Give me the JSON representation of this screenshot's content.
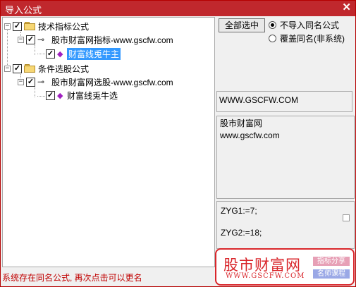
{
  "window": {
    "title": "导入公式",
    "close_glyph": "✕"
  },
  "tree": {
    "groups": [
      {
        "label": "技术指标公式",
        "child": "股市财富网指标-www.gscfw.com",
        "leaf": "财富线兎牛主",
        "leaf_selected": true
      },
      {
        "label": "条件选股公式",
        "child": "股市财富网选股-www.gscfw.com",
        "leaf": "财富线兎牛选",
        "leaf_selected": false
      }
    ]
  },
  "right": {
    "select_all_label": "全部选中",
    "radio_options": [
      {
        "label": "不导入同名公式",
        "selected": true
      },
      {
        "label": "覆盖同名(非系统)",
        "selected": false
      }
    ],
    "url_text": "WWW.GSCFW.COM",
    "description": [
      "股市财富网",
      "www.gscfw.com"
    ],
    "code_lines": [
      "ZYG1:=7;",
      "ZYG2:=18;"
    ]
  },
  "status_text": "系统存在同名公式, 再次点击可以更名",
  "brand": {
    "name": "股市财富网",
    "url": "WWW.GSCFW.COM",
    "tag1": "指标分享",
    "tag2": "名师课程"
  }
}
